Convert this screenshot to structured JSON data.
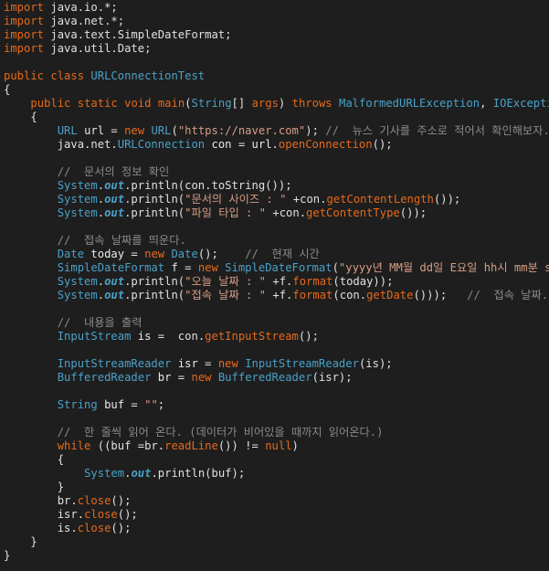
{
  "editor": {
    "language": "java",
    "theme": {
      "background": "#1e1e1e",
      "keyword": "#e66a1a",
      "type": "#4aa1c9",
      "string": "#d69d85",
      "comment": "#8a8a8a",
      "text": "#e0e0e0"
    },
    "lines": [
      {
        "indent": 0,
        "tokens": [
          {
            "t": "import",
            "k": "kw"
          },
          {
            "t": " java.io.*;",
            "k": "plain"
          }
        ]
      },
      {
        "indent": 0,
        "tokens": [
          {
            "t": "import",
            "k": "kw"
          },
          {
            "t": " java.net.*;",
            "k": "plain"
          }
        ]
      },
      {
        "indent": 0,
        "tokens": [
          {
            "t": "import",
            "k": "kw"
          },
          {
            "t": " java.text.SimpleDateFormat;",
            "k": "plain"
          }
        ]
      },
      {
        "indent": 0,
        "tokens": [
          {
            "t": "import",
            "k": "kw"
          },
          {
            "t": " java.util.Date;",
            "k": "plain"
          }
        ]
      },
      {
        "indent": 0,
        "tokens": []
      },
      {
        "indent": 0,
        "tokens": [
          {
            "t": "public",
            "k": "kw"
          },
          {
            "t": " ",
            "k": "plain"
          },
          {
            "t": "class",
            "k": "kw"
          },
          {
            "t": " ",
            "k": "plain"
          },
          {
            "t": "URLConnectionTest",
            "k": "cls"
          }
        ]
      },
      {
        "indent": 0,
        "tokens": [
          {
            "t": "{",
            "k": "plain"
          }
        ]
      },
      {
        "indent": 4,
        "tokens": [
          {
            "t": "public",
            "k": "kw"
          },
          {
            "t": " ",
            "k": "plain"
          },
          {
            "t": "static",
            "k": "kw"
          },
          {
            "t": " ",
            "k": "plain"
          },
          {
            "t": "void",
            "k": "kw"
          },
          {
            "t": " ",
            "k": "plain"
          },
          {
            "t": "main",
            "k": "kw"
          },
          {
            "t": "(",
            "k": "plain"
          },
          {
            "t": "String",
            "k": "cls"
          },
          {
            "t": "[] ",
            "k": "plain"
          },
          {
            "t": "args",
            "k": "kw"
          },
          {
            "t": ") ",
            "k": "plain"
          },
          {
            "t": "throws",
            "k": "kw"
          },
          {
            "t": " ",
            "k": "plain"
          },
          {
            "t": "MalformedURLException",
            "k": "cls"
          },
          {
            "t": ", ",
            "k": "plain"
          },
          {
            "t": "IOException",
            "k": "cls"
          }
        ]
      },
      {
        "indent": 4,
        "tokens": [
          {
            "t": "{",
            "k": "plain"
          }
        ]
      },
      {
        "indent": 8,
        "tokens": [
          {
            "t": "URL",
            "k": "cls"
          },
          {
            "t": " ",
            "k": "plain"
          },
          {
            "t": "url",
            "k": "var"
          },
          {
            "t": " = ",
            "k": "plain"
          },
          {
            "t": "new",
            "k": "kw"
          },
          {
            "t": " ",
            "k": "plain"
          },
          {
            "t": "URL",
            "k": "cls"
          },
          {
            "t": "(",
            "k": "plain"
          },
          {
            "t": "\"https://naver.com\"",
            "k": "str"
          },
          {
            "t": "); ",
            "k": "plain"
          },
          {
            "t": "//  뉴스 기사를 주소로 적어서 확인해보자.",
            "k": "cmt"
          }
        ]
      },
      {
        "indent": 8,
        "tokens": [
          {
            "t": "java.net.",
            "k": "plain"
          },
          {
            "t": "URLConnection",
            "k": "cls"
          },
          {
            "t": " ",
            "k": "plain"
          },
          {
            "t": "con",
            "k": "var"
          },
          {
            "t": " = ",
            "k": "plain"
          },
          {
            "t": "url",
            "k": "var"
          },
          {
            "t": ".",
            "k": "plain"
          },
          {
            "t": "openConnection",
            "k": "kw"
          },
          {
            "t": "();",
            "k": "plain"
          }
        ]
      },
      {
        "indent": 0,
        "tokens": []
      },
      {
        "indent": 8,
        "tokens": [
          {
            "t": "//  문서의 정보 확인",
            "k": "cmt"
          }
        ]
      },
      {
        "indent": 8,
        "tokens": [
          {
            "t": "System",
            "k": "cls"
          },
          {
            "t": ".",
            "k": "plain"
          },
          {
            "t": "out",
            "k": "field"
          },
          {
            "t": ".println(con.toString());",
            "k": "plain"
          }
        ]
      },
      {
        "indent": 8,
        "tokens": [
          {
            "t": "System",
            "k": "cls"
          },
          {
            "t": ".",
            "k": "plain"
          },
          {
            "t": "out",
            "k": "field"
          },
          {
            "t": ".println(",
            "k": "plain"
          },
          {
            "t": "\"문서의 사이즈 : \"",
            "k": "str"
          },
          {
            "t": " +con.",
            "k": "plain"
          },
          {
            "t": "getContentLength",
            "k": "kw"
          },
          {
            "t": "());",
            "k": "plain"
          }
        ]
      },
      {
        "indent": 8,
        "tokens": [
          {
            "t": "System",
            "k": "cls"
          },
          {
            "t": ".",
            "k": "plain"
          },
          {
            "t": "out",
            "k": "field"
          },
          {
            "t": ".println(",
            "k": "plain"
          },
          {
            "t": "\"파일 타입 : \"",
            "k": "str"
          },
          {
            "t": " +con.",
            "k": "plain"
          },
          {
            "t": "getContentType",
            "k": "kw"
          },
          {
            "t": "());",
            "k": "plain"
          }
        ]
      },
      {
        "indent": 0,
        "tokens": []
      },
      {
        "indent": 8,
        "tokens": [
          {
            "t": "//  접속 날짜를 띄운다.",
            "k": "cmt"
          }
        ]
      },
      {
        "indent": 8,
        "tokens": [
          {
            "t": "Date",
            "k": "cls"
          },
          {
            "t": " ",
            "k": "plain"
          },
          {
            "t": "today",
            "k": "var"
          },
          {
            "t": " = ",
            "k": "plain"
          },
          {
            "t": "new",
            "k": "kw"
          },
          {
            "t": " ",
            "k": "plain"
          },
          {
            "t": "Date",
            "k": "cls"
          },
          {
            "t": "();    ",
            "k": "plain"
          },
          {
            "t": "//  현재 시간",
            "k": "cmt"
          }
        ]
      },
      {
        "indent": 8,
        "tokens": [
          {
            "t": "SimpleDateFormat",
            "k": "cls"
          },
          {
            "t": " ",
            "k": "plain"
          },
          {
            "t": "f",
            "k": "var"
          },
          {
            "t": " = ",
            "k": "plain"
          },
          {
            "t": "new",
            "k": "kw"
          },
          {
            "t": " ",
            "k": "plain"
          },
          {
            "t": "SimpleDateFormat",
            "k": "cls"
          },
          {
            "t": "(",
            "k": "plain"
          },
          {
            "t": "\"yyyy년 MM월 dd일 E요일 hh시 mm분 ss초\"",
            "k": "str"
          },
          {
            "t": ");",
            "k": "plain"
          }
        ]
      },
      {
        "indent": 8,
        "tokens": [
          {
            "t": "System",
            "k": "cls"
          },
          {
            "t": ".",
            "k": "plain"
          },
          {
            "t": "out",
            "k": "field"
          },
          {
            "t": ".println(",
            "k": "plain"
          },
          {
            "t": "\"오늘 날짜 : \"",
            "k": "str"
          },
          {
            "t": " +f.",
            "k": "plain"
          },
          {
            "t": "format",
            "k": "kw"
          },
          {
            "t": "(today));",
            "k": "plain"
          }
        ]
      },
      {
        "indent": 8,
        "tokens": [
          {
            "t": "System",
            "k": "cls"
          },
          {
            "t": ".",
            "k": "plain"
          },
          {
            "t": "out",
            "k": "field"
          },
          {
            "t": ".println(",
            "k": "plain"
          },
          {
            "t": "\"접속 날짜 : \"",
            "k": "str"
          },
          {
            "t": " +f.",
            "k": "plain"
          },
          {
            "t": "format",
            "k": "kw"
          },
          {
            "t": "(con.",
            "k": "plain"
          },
          {
            "t": "getDate",
            "k": "kw"
          },
          {
            "t": "()));   ",
            "k": "plain"
          },
          {
            "t": "//  접속 날짜.",
            "k": "cmt"
          }
        ]
      },
      {
        "indent": 0,
        "tokens": []
      },
      {
        "indent": 8,
        "tokens": [
          {
            "t": "//  내용을 출력",
            "k": "cmt"
          }
        ]
      },
      {
        "indent": 8,
        "tokens": [
          {
            "t": "InputStream",
            "k": "cls"
          },
          {
            "t": " ",
            "k": "plain"
          },
          {
            "t": "is",
            "k": "var"
          },
          {
            "t": " =  con.",
            "k": "plain"
          },
          {
            "t": "getInputStream",
            "k": "kw"
          },
          {
            "t": "();",
            "k": "plain"
          }
        ]
      },
      {
        "indent": 0,
        "tokens": []
      },
      {
        "indent": 8,
        "tokens": [
          {
            "t": "InputStreamReader",
            "k": "cls"
          },
          {
            "t": " ",
            "k": "plain"
          },
          {
            "t": "isr",
            "k": "var"
          },
          {
            "t": " = ",
            "k": "plain"
          },
          {
            "t": "new",
            "k": "kw"
          },
          {
            "t": " ",
            "k": "plain"
          },
          {
            "t": "InputStreamReader",
            "k": "cls"
          },
          {
            "t": "(is);",
            "k": "plain"
          }
        ]
      },
      {
        "indent": 8,
        "tokens": [
          {
            "t": "BufferedReader",
            "k": "cls"
          },
          {
            "t": " ",
            "k": "plain"
          },
          {
            "t": "br",
            "k": "var"
          },
          {
            "t": " = ",
            "k": "plain"
          },
          {
            "t": "new",
            "k": "kw"
          },
          {
            "t": " ",
            "k": "plain"
          },
          {
            "t": "BufferedReader",
            "k": "cls"
          },
          {
            "t": "(isr);",
            "k": "plain"
          }
        ]
      },
      {
        "indent": 0,
        "tokens": []
      },
      {
        "indent": 8,
        "tokens": [
          {
            "t": "String",
            "k": "cls"
          },
          {
            "t": " ",
            "k": "plain"
          },
          {
            "t": "buf",
            "k": "var"
          },
          {
            "t": " = ",
            "k": "plain"
          },
          {
            "t": "\"\"",
            "k": "str"
          },
          {
            "t": ";",
            "k": "plain"
          }
        ]
      },
      {
        "indent": 0,
        "tokens": []
      },
      {
        "indent": 8,
        "tokens": [
          {
            "t": "//  한 줄씩 읽어 온다. (데이터가 비어있을 때까지 읽어온다.)",
            "k": "cmt"
          }
        ]
      },
      {
        "indent": 8,
        "tokens": [
          {
            "t": "while",
            "k": "kw"
          },
          {
            "t": " ((buf =br.",
            "k": "plain"
          },
          {
            "t": "readLine",
            "k": "kw"
          },
          {
            "t": "()) != ",
            "k": "plain"
          },
          {
            "t": "null",
            "k": "kw"
          },
          {
            "t": ")",
            "k": "plain"
          }
        ]
      },
      {
        "indent": 8,
        "tokens": [
          {
            "t": "{",
            "k": "plain"
          }
        ]
      },
      {
        "indent": 12,
        "tokens": [
          {
            "t": "System",
            "k": "cls"
          },
          {
            "t": ".",
            "k": "plain"
          },
          {
            "t": "out",
            "k": "field"
          },
          {
            "t": ".println(buf);",
            "k": "plain"
          }
        ]
      },
      {
        "indent": 8,
        "tokens": [
          {
            "t": "}",
            "k": "plain"
          }
        ]
      },
      {
        "indent": 8,
        "tokens": [
          {
            "t": "br.",
            "k": "plain"
          },
          {
            "t": "close",
            "k": "kw"
          },
          {
            "t": "();",
            "k": "plain"
          }
        ]
      },
      {
        "indent": 8,
        "tokens": [
          {
            "t": "isr.",
            "k": "plain"
          },
          {
            "t": "close",
            "k": "kw"
          },
          {
            "t": "();",
            "k": "plain"
          }
        ]
      },
      {
        "indent": 8,
        "tokens": [
          {
            "t": "is.",
            "k": "plain"
          },
          {
            "t": "close",
            "k": "kw"
          },
          {
            "t": "();",
            "k": "plain"
          }
        ]
      },
      {
        "indent": 4,
        "tokens": [
          {
            "t": "}",
            "k": "plain"
          }
        ]
      },
      {
        "indent": 0,
        "tokens": [
          {
            "t": "}",
            "k": "plain"
          }
        ]
      }
    ]
  }
}
